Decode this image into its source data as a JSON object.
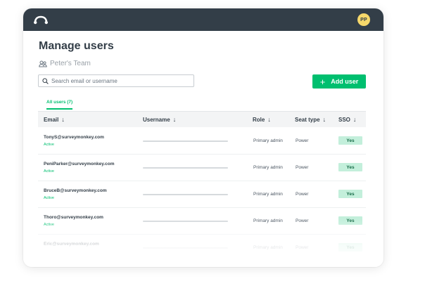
{
  "header": {
    "logo_icon": "surveymonkey-logo-icon",
    "avatar_initials": "PP",
    "colors": {
      "topbar": "#333e48",
      "avatar": "#f6d86b",
      "accent": "#00bf6f"
    }
  },
  "page": {
    "title": "Manage users",
    "team_icon": "team-icon",
    "team_name": "Peter's Team"
  },
  "search": {
    "placeholder": "Search email or username",
    "value": ""
  },
  "add_user": {
    "label": "Add user",
    "icon": "plus-icon"
  },
  "tabs": [
    {
      "label": "All users (7)",
      "active": true
    }
  ],
  "table": {
    "columns": [
      {
        "label": "Email",
        "sort_icon": "arrow-down-icon"
      },
      {
        "label": "Username",
        "sort_icon": "arrow-down-icon"
      },
      {
        "label": "Role",
        "sort_icon": "arrow-down-icon"
      },
      {
        "label": "Seat type",
        "sort_icon": "arrow-down-icon"
      },
      {
        "label": "SSO",
        "sort_icon": "arrow-down-icon"
      }
    ],
    "rows": [
      {
        "email": "TonyS@surveymonkey.com",
        "status": "Active",
        "role": "Primary admin",
        "seat": "Power",
        "sso": "Yes"
      },
      {
        "email": "PeniParker@surveymonkey.com",
        "status": "Active",
        "role": "Primary admin",
        "seat": "Power",
        "sso": "Yes"
      },
      {
        "email": "BruceB@surveymonkey.com",
        "status": "Active",
        "role": "Primary admin",
        "seat": "Power",
        "sso": "Yes"
      },
      {
        "email": "Thoro@surveymonkey.com",
        "status": "Active",
        "role": "Primary admin",
        "seat": "Power",
        "sso": "Yes"
      },
      {
        "email": "Eric@surveymonkey.com",
        "status": "",
        "role": "Primary admin",
        "seat": "Power",
        "sso": "Yes"
      }
    ]
  }
}
